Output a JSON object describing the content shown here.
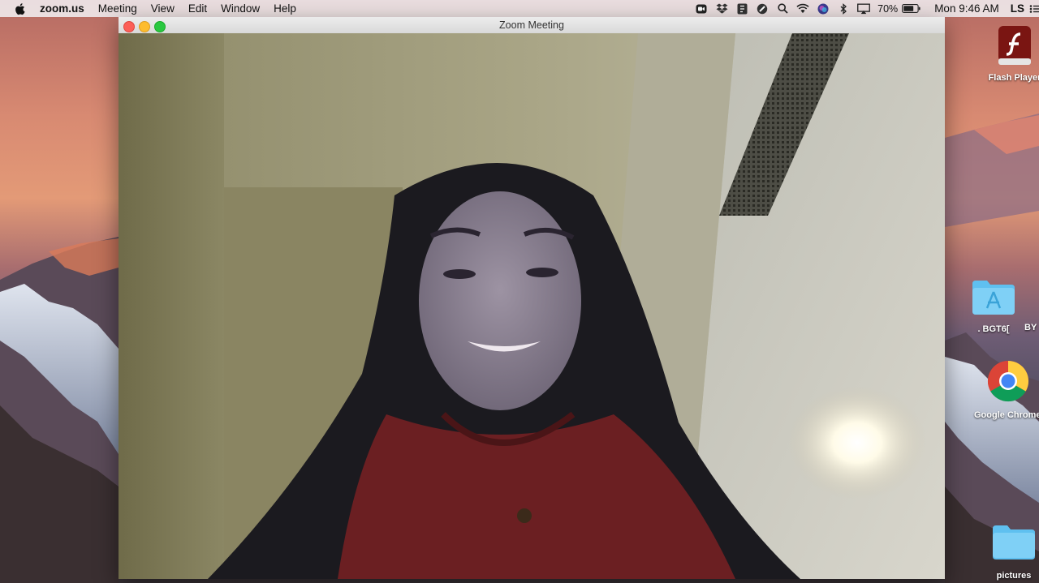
{
  "menubar": {
    "app_name": "zoom.us",
    "items": [
      "Meeting",
      "View",
      "Edit",
      "Window",
      "Help"
    ],
    "battery_percent": "70%",
    "clock": "Mon 9:46 AM",
    "user_initials": "LS",
    "status_icons": [
      "zoom-icon",
      "dropbox-icon",
      "notes-icon",
      "slash-icon",
      "search-icon",
      "wifi-icon",
      "siri-icon",
      "bluetooth-icon",
      "airplay-icon",
      "battery-icon",
      "list-icon"
    ]
  },
  "window": {
    "title": "Zoom Meeting",
    "controls": [
      "close",
      "minimize",
      "maximize"
    ]
  },
  "desktop": {
    "icons": [
      {
        "label": "Flash Player",
        "icon": "flash-icon"
      },
      {
        "label": ". BGT6[",
        "icon": "app-folder-icon"
      },
      {
        "label": "BY",
        "icon": "folder-icon"
      },
      {
        "label": "Google Chrome",
        "icon": "chrome-icon"
      },
      {
        "label": "pictures",
        "icon": "folder-icon"
      }
    ]
  },
  "colors": {
    "close": "#fc5f57",
    "minimize": "#fdbc2e",
    "maximize": "#29c840",
    "folder": "#5fc0f0"
  }
}
